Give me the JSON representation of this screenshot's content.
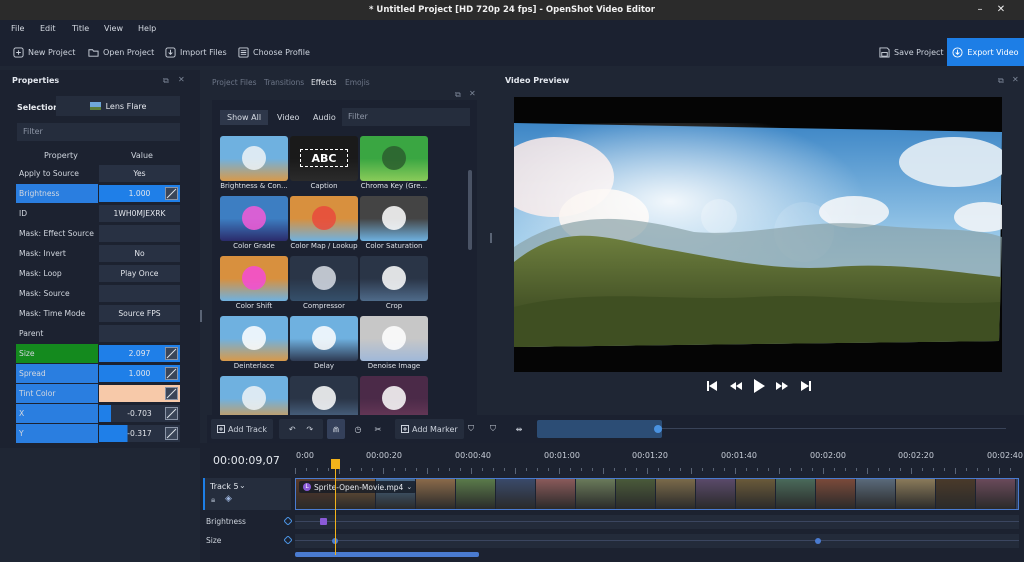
{
  "window": {
    "title": "* Untitled Project [HD 720p 24 fps] - OpenShot Video Editor",
    "min_icon": "minimize-icon",
    "close_icon": "close-icon"
  },
  "menu": [
    "File",
    "Edit",
    "Title",
    "View",
    "Help"
  ],
  "toolbar": {
    "new_project": "New Project",
    "open_project": "Open Project",
    "import_files": "Import Files",
    "choose_profile": "Choose Profile",
    "save_project": "Save Project",
    "export_video": "Export Video"
  },
  "properties": {
    "title": "Properties",
    "selection_label": "Selection:",
    "selection_value": "Lens Flare",
    "filter_placeholder": "Filter",
    "col_property": "Property",
    "col_value": "Value",
    "rows": [
      {
        "name": "Apply to Source",
        "value": "Yes",
        "highlight": ""
      },
      {
        "name": "Brightness",
        "value": "1.000",
        "highlight": "blue",
        "fill": 1.0
      },
      {
        "name": "ID",
        "value": "1WH0MJEXRK",
        "highlight": ""
      },
      {
        "name": "Mask: Effect Source",
        "value": "",
        "highlight": ""
      },
      {
        "name": "Mask: Invert",
        "value": "No",
        "highlight": ""
      },
      {
        "name": "Mask: Loop",
        "value": "Play Once",
        "highlight": ""
      },
      {
        "name": "Mask: Source",
        "value": "",
        "highlight": ""
      },
      {
        "name": "Mask: Time Mode",
        "value": "Source FPS",
        "highlight": ""
      },
      {
        "name": "Parent",
        "value": "",
        "highlight": ""
      },
      {
        "name": "Size",
        "value": "2.097",
        "highlight": "green",
        "fill": 1.0
      },
      {
        "name": "Spread",
        "value": "1.000",
        "highlight": "blue",
        "fill": 1.0
      },
      {
        "name": "Tint Color",
        "value": "",
        "highlight": "blue",
        "color": "#f7c9a9"
      },
      {
        "name": "X",
        "value": "-0.703",
        "highlight": "blue",
        "fill": 0.15
      },
      {
        "name": "Y",
        "value": "-0.317",
        "highlight": "blue",
        "fill": 0.35
      }
    ]
  },
  "effects": {
    "tabs": [
      "Project Files",
      "Transitions",
      "Effects",
      "Emojis"
    ],
    "active_tab": "Effects",
    "sub_tabs": [
      "Show All",
      "Video",
      "Audio"
    ],
    "filter_placeholder": "Filter",
    "items": [
      {
        "label": "Brightness & Con...",
        "icon": "brightness-icon"
      },
      {
        "label": "Caption",
        "icon": "caption-icon",
        "thumb_text": "ABC"
      },
      {
        "label": "Chroma Key (Gre...",
        "icon": "chroma-key-icon"
      },
      {
        "label": "Color Grade",
        "icon": "color-grade-icon"
      },
      {
        "label": "Color Map / Lookup",
        "icon": "color-map-icon"
      },
      {
        "label": "Color Saturation",
        "icon": "color-saturation-icon"
      },
      {
        "label": "Color Shift",
        "icon": "color-shift-icon"
      },
      {
        "label": "Compressor",
        "icon": "compressor-icon"
      },
      {
        "label": "Crop",
        "icon": "crop-icon"
      },
      {
        "label": "Deinterlace",
        "icon": "deinterlace-icon"
      },
      {
        "label": "Delay",
        "icon": "delay-icon"
      },
      {
        "label": "Denoise Image",
        "icon": "denoise-icon"
      },
      {
        "label": "",
        "icon": "effect-icon"
      },
      {
        "label": "",
        "icon": "audio-effect-icon"
      },
      {
        "label": "",
        "icon": "echo-icon"
      }
    ]
  },
  "preview": {
    "title": "Video Preview",
    "controls": [
      "skip-start-icon",
      "rewind-icon",
      "play-icon",
      "fast-forward-icon",
      "skip-end-icon"
    ]
  },
  "timeline_toolbar": {
    "add_track": "Add Track",
    "add_marker": "Add Marker"
  },
  "timeline": {
    "current_time": "00:00:09,07",
    "ruler": [
      "0:00",
      "00:00:20",
      "00:00:40",
      "00:01:00",
      "00:01:20",
      "00:01:40",
      "00:02:00",
      "00:02:20",
      "00:02:40"
    ],
    "track_name": "Track 5",
    "clip_name": "Sprite-Open-Movie.mp4",
    "keyframe_rows": [
      "Brightness",
      "Size"
    ]
  }
}
